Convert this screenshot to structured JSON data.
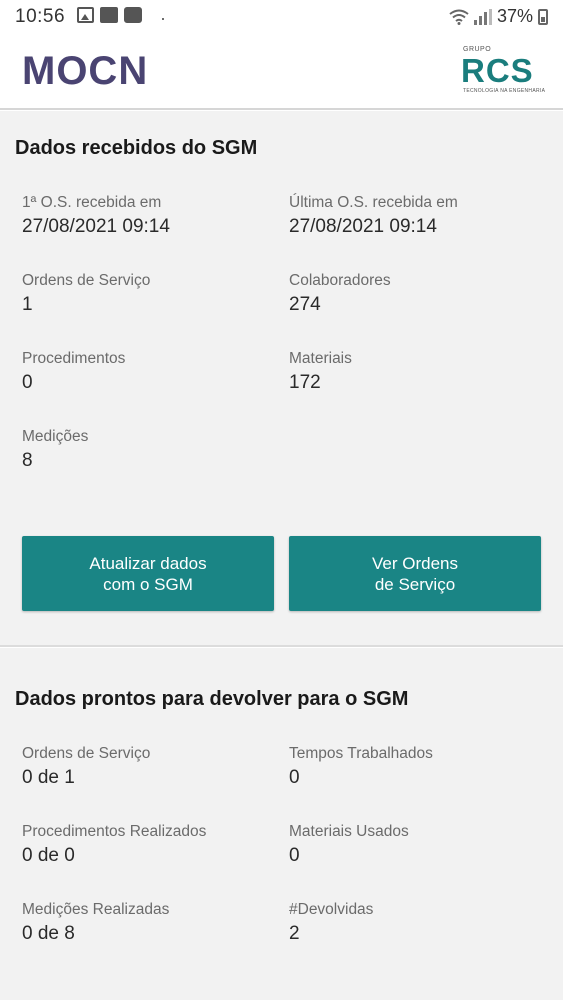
{
  "status_bar": {
    "time": "10:56",
    "dot": "·",
    "battery_pct": "37%",
    "icons": [
      "gallery-icon",
      "voicemail-icon",
      "teams-icon",
      "wifi-icon",
      "signal-icon",
      "battery-icon"
    ]
  },
  "header": {
    "logo_left": "MOCN",
    "logo_right_group": "GRUPO",
    "logo_right_main": "RCS",
    "logo_right_sub": "TECNOLOGIA NA ENGENHARIA"
  },
  "received": {
    "title": "Dados recebidos do SGM",
    "fields": [
      {
        "label": "1ª O.S. recebida em",
        "value": "27/08/2021 09:14"
      },
      {
        "label": "Última O.S. recebida em",
        "value": "27/08/2021 09:14"
      },
      {
        "label": "Ordens de Serviço",
        "value": "1"
      },
      {
        "label": "Colaboradores",
        "value": "274"
      },
      {
        "label": "Procedimentos",
        "value": "0"
      },
      {
        "label": "Materiais",
        "value": "172"
      },
      {
        "label": "Medições",
        "value": "8"
      }
    ],
    "btn_update": "Atualizar dados\ncom o SGM",
    "btn_orders": "Ver Ordens\nde Serviço"
  },
  "ready": {
    "title": "Dados prontos para devolver para o SGM",
    "fields": [
      {
        "label": "Ordens de Serviço",
        "value": "0 de 1"
      },
      {
        "label": "Tempos Trabalhados",
        "value": "0"
      },
      {
        "label": "Procedimentos Realizados",
        "value": "0 de 0"
      },
      {
        "label": "Materiais Usados",
        "value": "0"
      },
      {
        "label": "Medições Realizadas",
        "value": "0 de 8"
      },
      {
        "label": "#Devolvidas",
        "value": "2"
      }
    ]
  },
  "colors": {
    "accent": "#1a8585",
    "logo_mocn": "#4a4472",
    "logo_rcs": "#1a7d7d",
    "card_bg": "#f2f2f2"
  }
}
